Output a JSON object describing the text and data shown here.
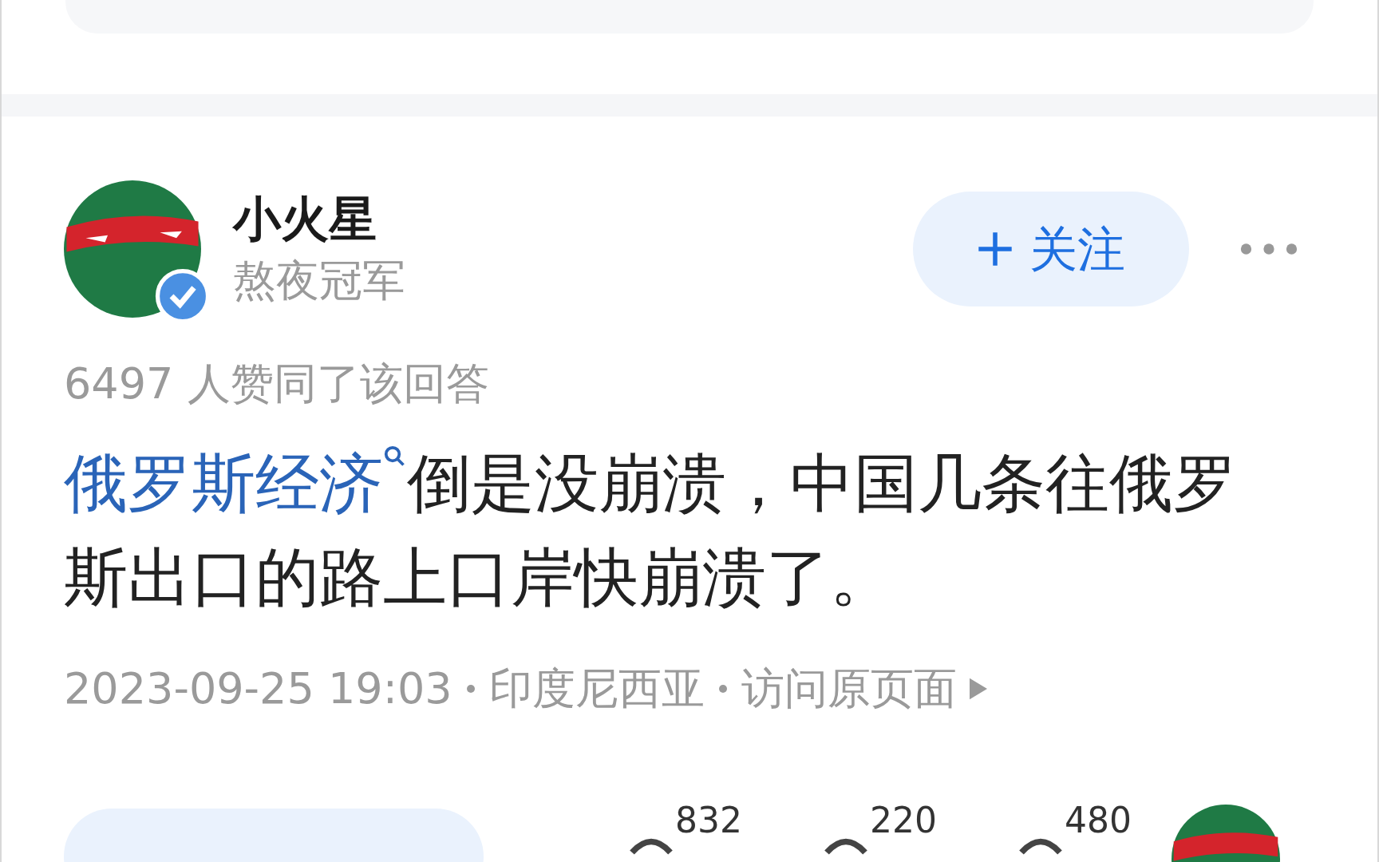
{
  "author": {
    "name": "小火星",
    "title": "熬夜冠军",
    "verified": true
  },
  "follow_button": {
    "label": "关注"
  },
  "upvote_summary": "6497 人赞同了该回答",
  "answer": {
    "link": "俄罗斯经济",
    "text": "倒是没崩溃，中国几条往俄罗斯出口的路上口岸快崩溃了。"
  },
  "meta": {
    "time": "2023-09-25 19:03",
    "location": "印度尼西亚",
    "link": "访问原页面"
  },
  "actions": [
    {
      "count": "832"
    },
    {
      "count": "220"
    },
    {
      "count": "480"
    }
  ]
}
